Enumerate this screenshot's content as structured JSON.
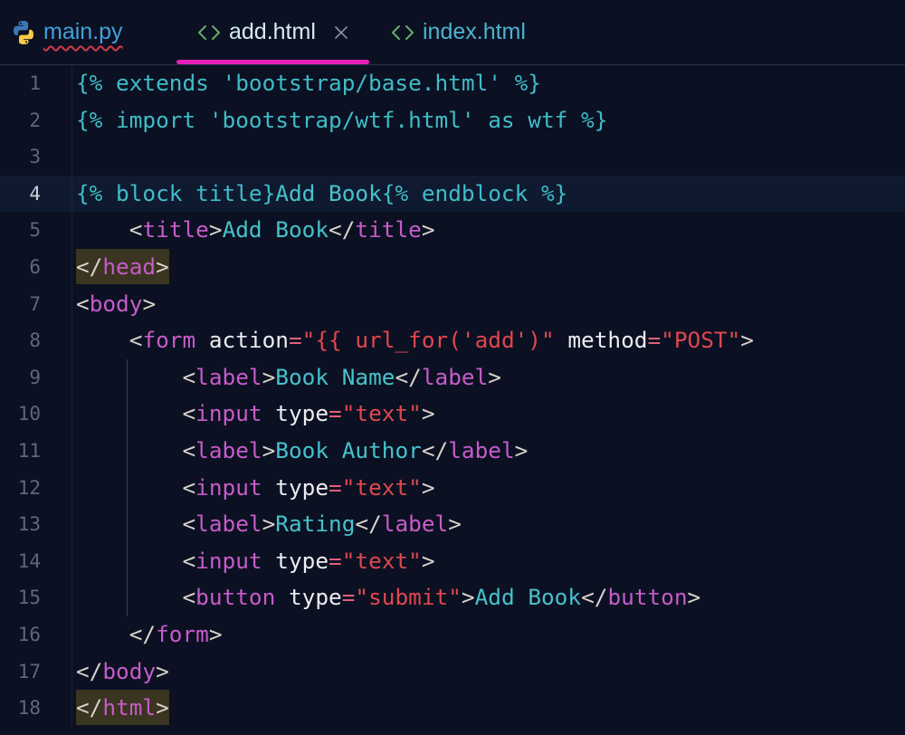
{
  "tabs": [
    {
      "label": "main.py",
      "icon": "python-file-icon",
      "active": false,
      "has_error": true
    },
    {
      "label": "add.html",
      "icon": "html-file-icon",
      "active": true,
      "closable": true
    },
    {
      "label": "index.html",
      "icon": "html-file-icon",
      "active": false
    }
  ],
  "colors": {
    "accent": "#e81fb4",
    "error_underline": "#d23a4a",
    "html_icon": "#67ad6b",
    "current_line_bg": "#0f1a30",
    "match_bg": "#3a3520"
  },
  "syntax_colors": {
    "jinja": "#3fbcc8",
    "text": "#47c1cc",
    "punct": "#d9d2ca",
    "tag": "#c75bc9",
    "attr": "#ececf0",
    "eq": "#e0607a",
    "string": "#e0474f"
  },
  "editor": {
    "current_line": 4,
    "lines": [
      {
        "number": 1,
        "tokens": [
          {
            "k": "jinja",
            "t": "{% extends 'bootstrap/base.html' %}"
          }
        ]
      },
      {
        "number": 2,
        "tokens": [
          {
            "k": "jinja",
            "t": "{% import 'bootstrap/wtf.html' as wtf %}"
          }
        ]
      },
      {
        "number": 3,
        "tokens": []
      },
      {
        "number": 4,
        "tokens": [
          {
            "k": "jinja",
            "t": "{% block title}"
          },
          {
            "k": "text",
            "t": "Add Book"
          },
          {
            "k": "jinja",
            "t": "{% endblock %}"
          }
        ]
      },
      {
        "number": 5,
        "tokens": [
          {
            "k": "ws",
            "t": "    "
          },
          {
            "k": "punct",
            "t": "<"
          },
          {
            "k": "tag",
            "t": "title"
          },
          {
            "k": "punct",
            "t": ">"
          },
          {
            "k": "text",
            "t": "Add Book"
          },
          {
            "k": "punct",
            "t": "</"
          },
          {
            "k": "tag",
            "t": "title"
          },
          {
            "k": "punct",
            "t": ">"
          }
        ]
      },
      {
        "number": 6,
        "tokens": [
          {
            "k": "punct",
            "t": "</",
            "m": true
          },
          {
            "k": "tag",
            "t": "head",
            "m": true
          },
          {
            "k": "punct",
            "t": ">",
            "m": true
          }
        ]
      },
      {
        "number": 7,
        "tokens": [
          {
            "k": "punct",
            "t": "<"
          },
          {
            "k": "tag",
            "t": "body"
          },
          {
            "k": "punct",
            "t": ">"
          }
        ]
      },
      {
        "number": 8,
        "tokens": [
          {
            "k": "ws",
            "t": "    "
          },
          {
            "k": "punct",
            "t": "<"
          },
          {
            "k": "tag",
            "t": "form"
          },
          {
            "k": "ws",
            "t": " "
          },
          {
            "k": "attr",
            "t": "action"
          },
          {
            "k": "eq",
            "t": "="
          },
          {
            "k": "string",
            "t": "\"{{ url_for('add')\""
          },
          {
            "k": "ws",
            "t": " "
          },
          {
            "k": "attr",
            "t": "method"
          },
          {
            "k": "eq",
            "t": "="
          },
          {
            "k": "string",
            "t": "\"POST\""
          },
          {
            "k": "punct",
            "t": ">"
          }
        ]
      },
      {
        "number": 9,
        "tokens": [
          {
            "k": "ws",
            "t": "        "
          },
          {
            "k": "punct",
            "t": "<"
          },
          {
            "k": "tag",
            "t": "label"
          },
          {
            "k": "punct",
            "t": ">"
          },
          {
            "k": "text",
            "t": "Book Name"
          },
          {
            "k": "punct",
            "t": "</"
          },
          {
            "k": "tag",
            "t": "label"
          },
          {
            "k": "punct",
            "t": ">"
          }
        ]
      },
      {
        "number": 10,
        "tokens": [
          {
            "k": "ws",
            "t": "        "
          },
          {
            "k": "punct",
            "t": "<"
          },
          {
            "k": "tag",
            "t": "input"
          },
          {
            "k": "ws",
            "t": " "
          },
          {
            "k": "attr",
            "t": "type"
          },
          {
            "k": "eq",
            "t": "="
          },
          {
            "k": "string",
            "t": "\"text\""
          },
          {
            "k": "punct",
            "t": ">"
          }
        ]
      },
      {
        "number": 11,
        "tokens": [
          {
            "k": "ws",
            "t": "        "
          },
          {
            "k": "punct",
            "t": "<"
          },
          {
            "k": "tag",
            "t": "label"
          },
          {
            "k": "punct",
            "t": ">"
          },
          {
            "k": "text",
            "t": "Book Author"
          },
          {
            "k": "punct",
            "t": "</"
          },
          {
            "k": "tag",
            "t": "label"
          },
          {
            "k": "punct",
            "t": ">"
          }
        ]
      },
      {
        "number": 12,
        "tokens": [
          {
            "k": "ws",
            "t": "        "
          },
          {
            "k": "punct",
            "t": "<"
          },
          {
            "k": "tag",
            "t": "input"
          },
          {
            "k": "ws",
            "t": " "
          },
          {
            "k": "attr",
            "t": "type"
          },
          {
            "k": "eq",
            "t": "="
          },
          {
            "k": "string",
            "t": "\"text\""
          },
          {
            "k": "punct",
            "t": ">"
          }
        ]
      },
      {
        "number": 13,
        "tokens": [
          {
            "k": "ws",
            "t": "        "
          },
          {
            "k": "punct",
            "t": "<"
          },
          {
            "k": "tag",
            "t": "label"
          },
          {
            "k": "punct",
            "t": ">"
          },
          {
            "k": "text",
            "t": "Rating"
          },
          {
            "k": "punct",
            "t": "</"
          },
          {
            "k": "tag",
            "t": "label"
          },
          {
            "k": "punct",
            "t": ">"
          }
        ]
      },
      {
        "number": 14,
        "tokens": [
          {
            "k": "ws",
            "t": "        "
          },
          {
            "k": "punct",
            "t": "<"
          },
          {
            "k": "tag",
            "t": "input"
          },
          {
            "k": "ws",
            "t": " "
          },
          {
            "k": "attr",
            "t": "type"
          },
          {
            "k": "eq",
            "t": "="
          },
          {
            "k": "string",
            "t": "\"text\""
          },
          {
            "k": "punct",
            "t": ">"
          }
        ]
      },
      {
        "number": 15,
        "tokens": [
          {
            "k": "ws",
            "t": "        "
          },
          {
            "k": "punct",
            "t": "<"
          },
          {
            "k": "tag",
            "t": "button"
          },
          {
            "k": "ws",
            "t": " "
          },
          {
            "k": "attr",
            "t": "type"
          },
          {
            "k": "eq",
            "t": "="
          },
          {
            "k": "string",
            "t": "\"submit\""
          },
          {
            "k": "punct",
            "t": ">"
          },
          {
            "k": "text",
            "t": "Add Book"
          },
          {
            "k": "punct",
            "t": "</"
          },
          {
            "k": "tag",
            "t": "button"
          },
          {
            "k": "punct",
            "t": ">"
          }
        ]
      },
      {
        "number": 16,
        "tokens": [
          {
            "k": "ws",
            "t": "    "
          },
          {
            "k": "punct",
            "t": "</"
          },
          {
            "k": "tag",
            "t": "form"
          },
          {
            "k": "punct",
            "t": ">"
          }
        ]
      },
      {
        "number": 17,
        "tokens": [
          {
            "k": "punct",
            "t": "</"
          },
          {
            "k": "tag",
            "t": "body"
          },
          {
            "k": "punct",
            "t": ">"
          }
        ]
      },
      {
        "number": 18,
        "tokens": [
          {
            "k": "punct",
            "t": "</",
            "m": true
          },
          {
            "k": "tag",
            "t": "html",
            "m": true
          },
          {
            "k": "punct",
            "t": ">",
            "m": true
          }
        ]
      }
    ]
  }
}
